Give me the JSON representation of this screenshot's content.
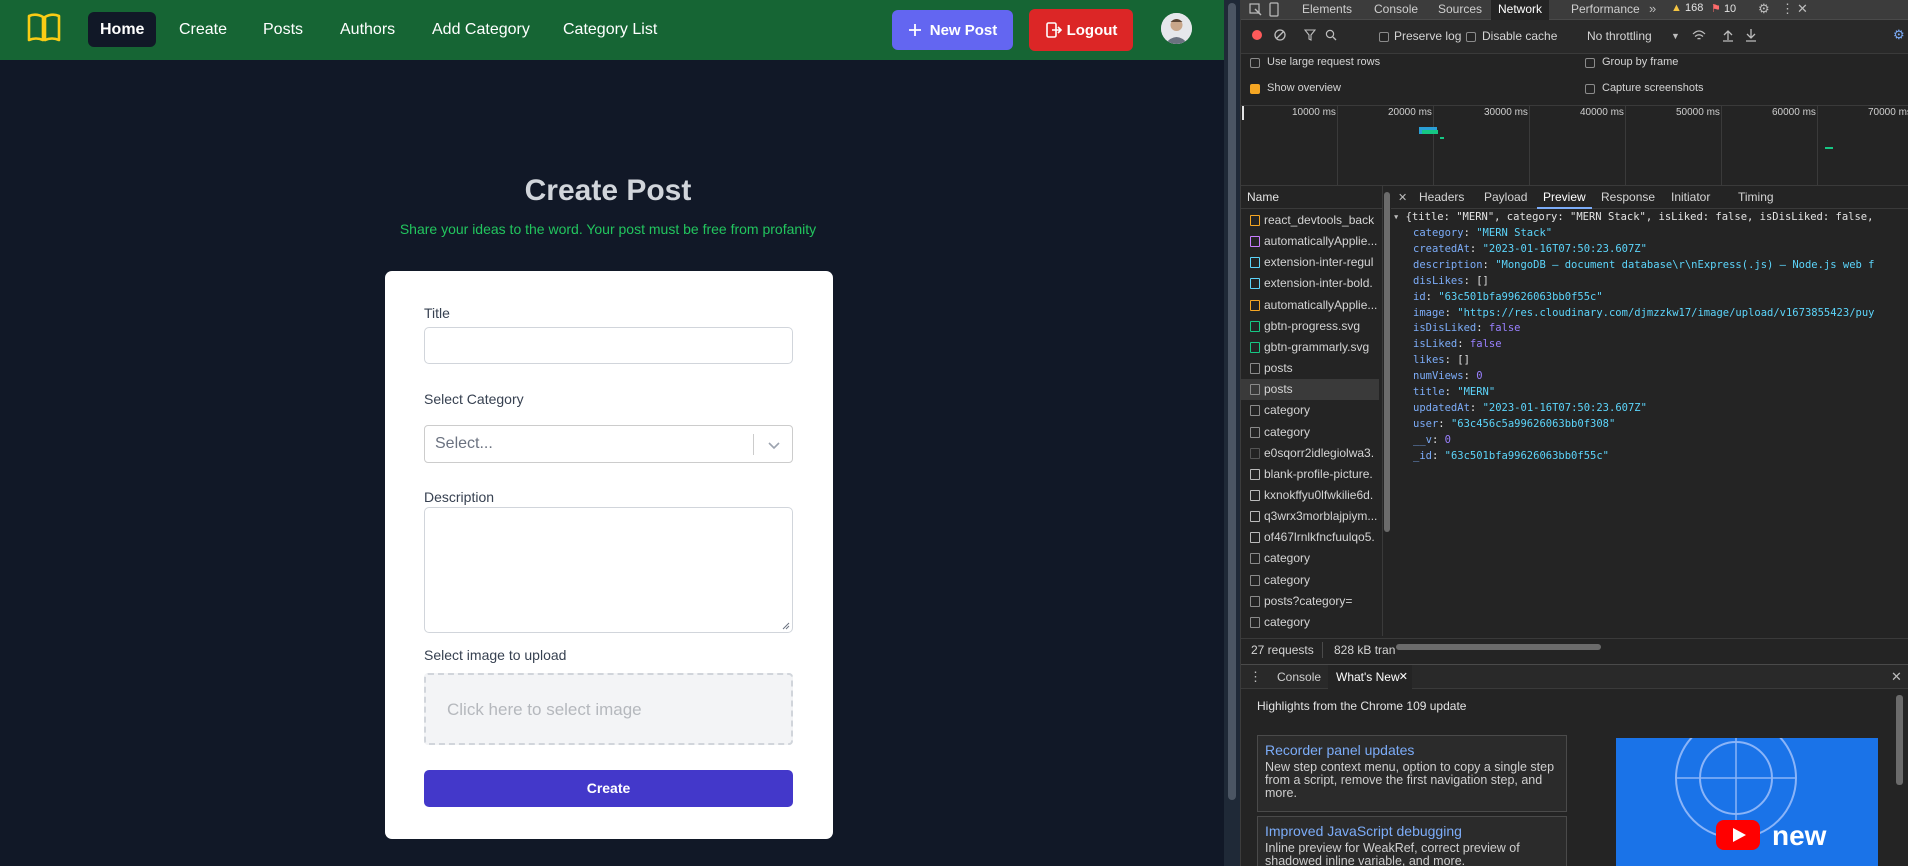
{
  "nav": {
    "items": [
      "Home",
      "Create",
      "Posts",
      "Authors",
      "Add Category",
      "Category List"
    ],
    "new_post": "New Post",
    "logout": "Logout"
  },
  "page": {
    "title": "Create Post",
    "subtitle": "Share your ideas to the word. Your post must be free from profanity"
  },
  "form": {
    "title_label": "Title",
    "category_label": "Select Category",
    "category_placeholder": "Select...",
    "description_label": "Description",
    "image_label": "Select image to upload",
    "image_placeholder": "Click here to select image",
    "submit": "Create"
  },
  "devtools": {
    "tabs": [
      "Elements",
      "Console",
      "Sources",
      "Network",
      "Performance"
    ],
    "warnings": "168",
    "errors": "10",
    "toolbar": {
      "preserve_log": "Preserve log",
      "disable_cache": "Disable cache",
      "throttling": "No throttling"
    },
    "options": {
      "large_rows": "Use large request rows",
      "group_by_frame": "Group by frame",
      "show_overview": "Show overview",
      "capture_screenshots": "Capture screenshots"
    },
    "timeline_ticks": [
      "10000 ms",
      "20000 ms",
      "30000 ms",
      "40000 ms",
      "50000 ms",
      "60000 ms",
      "70000 ms"
    ],
    "name_header": "Name",
    "requests": [
      "react_devtools_back",
      "automaticallyApplie...",
      "extension-inter-regul",
      "extension-inter-bold.",
      "automaticallyApplie...",
      "gbtn-progress.svg",
      "gbtn-grammarly.svg",
      "posts",
      "posts",
      "category",
      "category",
      "e0sqorr2idlegiolwa3.",
      "blank-profile-picture.",
      "kxnokffyu0lfwkilie6d.",
      "q3wrx3morblajpiym...",
      "of467lrnlkfncfuulqo5.",
      "category",
      "category",
      "posts?category=",
      "category"
    ],
    "preview_tabs": [
      "Headers",
      "Payload",
      "Preview",
      "Response",
      "Initiator",
      "Timing"
    ],
    "json_summary": "{title: \"MERN\", category: \"MERN Stack\", isLiked: false, isDisLiked: false,",
    "json_fields": [
      {
        "key": "category",
        "value": "\"MERN Stack\"",
        "kind": "str"
      },
      {
        "key": "createdAt",
        "value": "\"2023-01-16T07:50:23.607Z\"",
        "kind": "str"
      },
      {
        "key": "description",
        "value": "\"MongoDB — document database\\r\\nExpress(.js) — Node.js web f",
        "kind": "str"
      },
      {
        "key": "disLikes",
        "value": "[]",
        "kind": "punct"
      },
      {
        "key": "id",
        "value": "\"63c501bfa99626063bb0f55c\"",
        "kind": "str"
      },
      {
        "key": "image",
        "value": "\"https://res.cloudinary.com/djmzzkw17/image/upload/v1673855423/puy",
        "kind": "str"
      },
      {
        "key": "isDisLiked",
        "value": "false",
        "kind": "bool"
      },
      {
        "key": "isLiked",
        "value": "false",
        "kind": "bool"
      },
      {
        "key": "likes",
        "value": "[]",
        "kind": "punct"
      },
      {
        "key": "numViews",
        "value": "0",
        "kind": "num"
      },
      {
        "key": "title",
        "value": "\"MERN\"",
        "kind": "str"
      },
      {
        "key": "updatedAt",
        "value": "\"2023-01-16T07:50:23.607Z\"",
        "kind": "str"
      },
      {
        "key": "user",
        "value": "\"63c456c5a99626063bb0f308\"",
        "kind": "str"
      },
      {
        "key": "__v",
        "value": "0",
        "kind": "num"
      },
      {
        "key": "_id",
        "value": "\"63c501bfa99626063bb0f55c\"",
        "kind": "str"
      }
    ],
    "status": {
      "requests": "27 requests",
      "transferred": "828 kB tran"
    },
    "drawer": {
      "tabs": [
        "Console",
        "What's New"
      ],
      "heading": "Highlights from the Chrome 109 update",
      "cards": [
        {
          "title": "Recorder panel updates",
          "desc": "New step context menu, option to copy a single step from a script, remove the first navigation step, and more."
        },
        {
          "title": "Improved JavaScript debugging",
          "desc": "Inline preview for WeakRef, correct preview of shadowed inline variable, and more."
        }
      ],
      "video_text": "new"
    }
  },
  "colors": {
    "nav_bg": "#166534",
    "page_bg": "#111827",
    "new_post_btn": "#6366f1",
    "logout_btn": "#dc2626",
    "create_btn": "#4338ca",
    "subtitle": "#22c55e"
  }
}
